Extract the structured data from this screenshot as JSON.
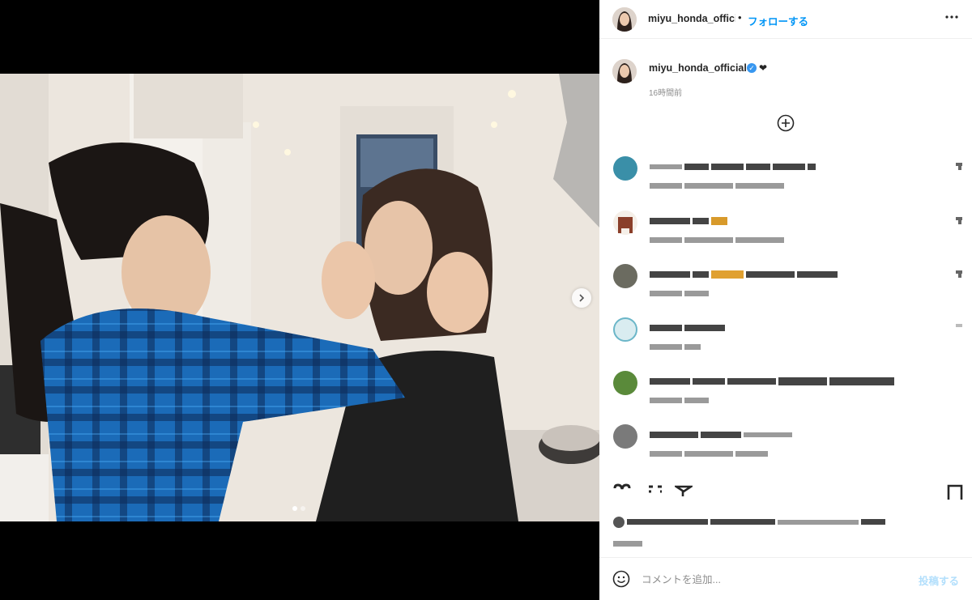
{
  "post": {
    "username": "miyu_honda_official",
    "header_separator": "•",
    "follow_label": "フォローする",
    "more_icon": "more-horizontal-icon",
    "caption_text": "❤",
    "time_ago": "16時間前",
    "carousel": {
      "total_images": 2,
      "current_index": 1
    }
  },
  "comment_form": {
    "placeholder": "コメントを追加...",
    "post_label": "投稿する"
  },
  "colors": {
    "link_blue": "#0095f6",
    "verified_blue": "#3897f0",
    "post_disabled": "#b2dffc",
    "muted": "#8e8e8e"
  },
  "icons": [
    "load-more-comments-icon",
    "like-icon",
    "comment-icon",
    "share-icon",
    "save-icon",
    "emoji-icon",
    "verified-badge-icon",
    "next-image-icon"
  ]
}
